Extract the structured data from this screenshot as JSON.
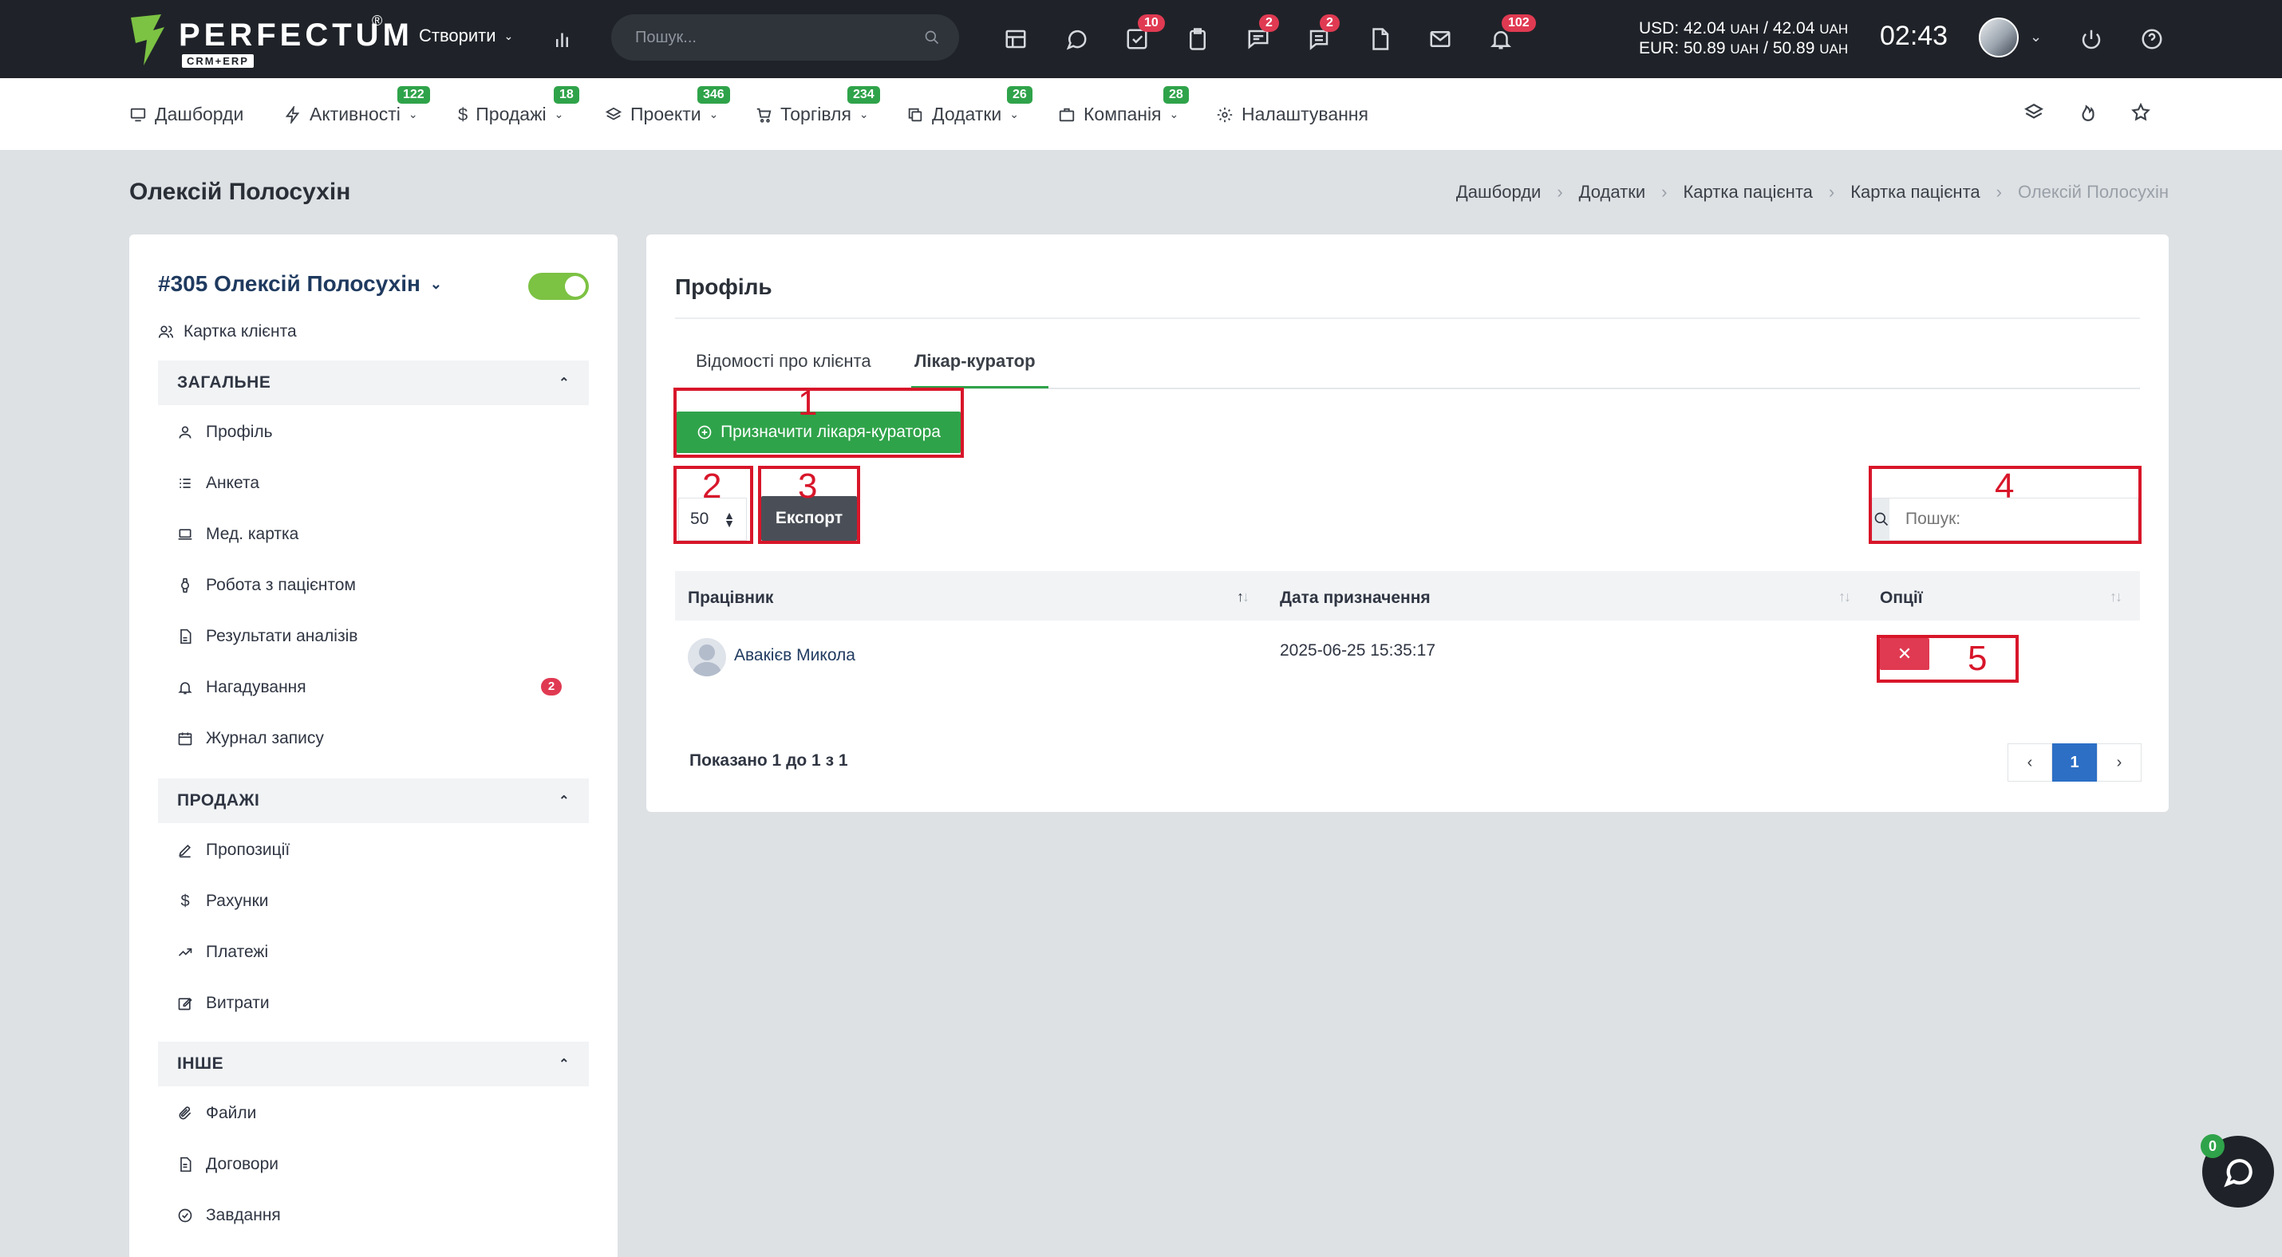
{
  "app": {
    "logo_text": "PERFECTUM",
    "logo_sub": "CRM+ERP",
    "logo_reg": "®",
    "create_label": "Створити",
    "search_placeholder": "Пошук...",
    "rates": {
      "usd_label": "USD: 42.04",
      "usd_unit1": "UAH",
      "usd_sep": "/ 42.04",
      "usd_unit2": "UAH",
      "eur_label": "EUR: 50.89",
      "eur_unit1": "UAH",
      "eur_sep": "/ 50.89",
      "eur_unit2": "UAH"
    },
    "clock": "02:43",
    "top_badges": {
      "tasks": "10",
      "chats": "2",
      "messages": "2",
      "notifications": "102"
    }
  },
  "nav": {
    "items": [
      {
        "label": "Дашборди",
        "badge": ""
      },
      {
        "label": "Активності",
        "badge": "122"
      },
      {
        "label": "Продажі",
        "badge": "18"
      },
      {
        "label": "Проекти",
        "badge": "346"
      },
      {
        "label": "Торгівля",
        "badge": "234"
      },
      {
        "label": "Додатки",
        "badge": "26"
      },
      {
        "label": "Компанія",
        "badge": "28"
      },
      {
        "label": "Налаштування",
        "badge": ""
      }
    ]
  },
  "page": {
    "title": "Олексій Полосухін",
    "breadcrumb": [
      "Дашборди",
      "Додатки",
      "Картка пацієнта",
      "Картка пацієнта",
      "Олексій Полосухін"
    ]
  },
  "sidebar": {
    "client_name": "#305 Олексій Полосухін",
    "client_card_link": "Картка клієнта",
    "sections": [
      {
        "title": "ЗАГАЛЬНЕ",
        "items": [
          {
            "label": "Профіль",
            "icon": "user-icon"
          },
          {
            "label": "Анкета",
            "icon": "list-icon"
          },
          {
            "label": "Мед. картка",
            "icon": "laptop-icon"
          },
          {
            "label": "Робота з пацієнтом",
            "icon": "watch-icon"
          },
          {
            "label": "Результати аналізів",
            "icon": "file-icon"
          },
          {
            "label": "Нагадування",
            "icon": "bell-icon",
            "badge": "2"
          },
          {
            "label": "Журнал запису",
            "icon": "calendar-icon"
          }
        ]
      },
      {
        "title": "ПРОДАЖІ",
        "items": [
          {
            "label": "Пропозиції",
            "icon": "pen-icon"
          },
          {
            "label": "Рахунки",
            "icon": "dollar-icon"
          },
          {
            "label": "Платежі",
            "icon": "trend-icon"
          },
          {
            "label": "Витрати",
            "icon": "edit-icon"
          }
        ]
      },
      {
        "title": "ІНШЕ",
        "items": [
          {
            "label": "Файли",
            "icon": "paperclip-icon"
          },
          {
            "label": "Договори",
            "icon": "document-icon"
          },
          {
            "label": "Завдання",
            "icon": "check-circle-icon"
          }
        ]
      }
    ]
  },
  "main": {
    "title": "Профіль",
    "tabs": [
      "Відомості про клієнта",
      "Лікар-куратор"
    ],
    "assign_button": "Призначити лікаря-куратора",
    "page_length": "50",
    "export_button": "Експорт",
    "search_placeholder": "Пошук:",
    "table": {
      "headers": [
        "Працівник",
        "Дата призначення",
        "Опції"
      ],
      "rows": [
        {
          "employee": "Авакієв Микола",
          "date": "2025-06-25 15:35:17"
        }
      ]
    },
    "shown_text": "Показано 1 до 1 з 1",
    "pager": {
      "prev": "‹",
      "current": "1",
      "next": "›"
    },
    "annotations": [
      "1",
      "2",
      "3",
      "4",
      "5"
    ]
  },
  "chat": {
    "badge": "0"
  },
  "colors": {
    "topbar": "#1f2329",
    "accent_green": "#2fa34a",
    "badge_red": "#e03a52",
    "annotation_red": "#d8162a",
    "pager_blue": "#2c6fc5"
  }
}
